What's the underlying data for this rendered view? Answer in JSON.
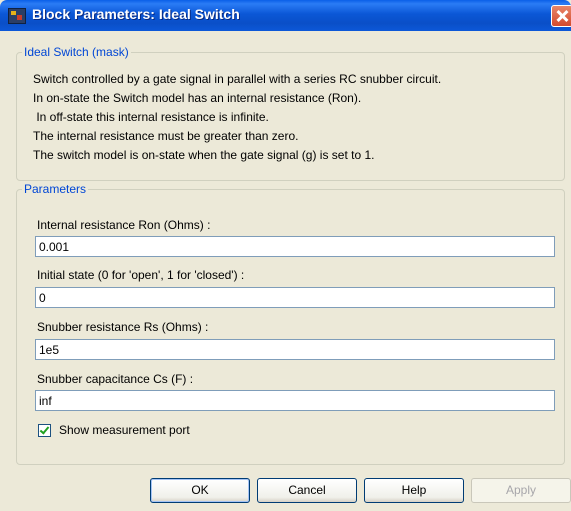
{
  "window": {
    "title": "Block Parameters: Ideal Switch"
  },
  "mask": {
    "legend": "Ideal Switch (mask)",
    "description": [
      "Switch controlled by a gate signal in parallel with a series RC snubber circuit.",
      "In on-state the Switch model has an internal resistance (Ron).",
      " In off-state this internal resistance is infinite.",
      "The internal resistance must be greater than zero.",
      "The switch model is on-state when the gate signal (g) is set to 1."
    ]
  },
  "parameters": {
    "legend": "Parameters",
    "fields": [
      {
        "label": "Internal resistance Ron (Ohms) :",
        "value": "0.001"
      },
      {
        "label": "Initial state (0 for 'open', 1 for 'closed') :",
        "value": "0"
      },
      {
        "label": "Snubber resistance Rs (Ohms) :",
        "value": "1e5"
      },
      {
        "label": "Snubber capacitance Cs (F) :",
        "value": "inf"
      }
    ],
    "show_measurement_port": {
      "label": "Show measurement port",
      "checked": true
    }
  },
  "buttons": {
    "ok": "OK",
    "cancel": "Cancel",
    "help": "Help",
    "apply": "Apply"
  }
}
